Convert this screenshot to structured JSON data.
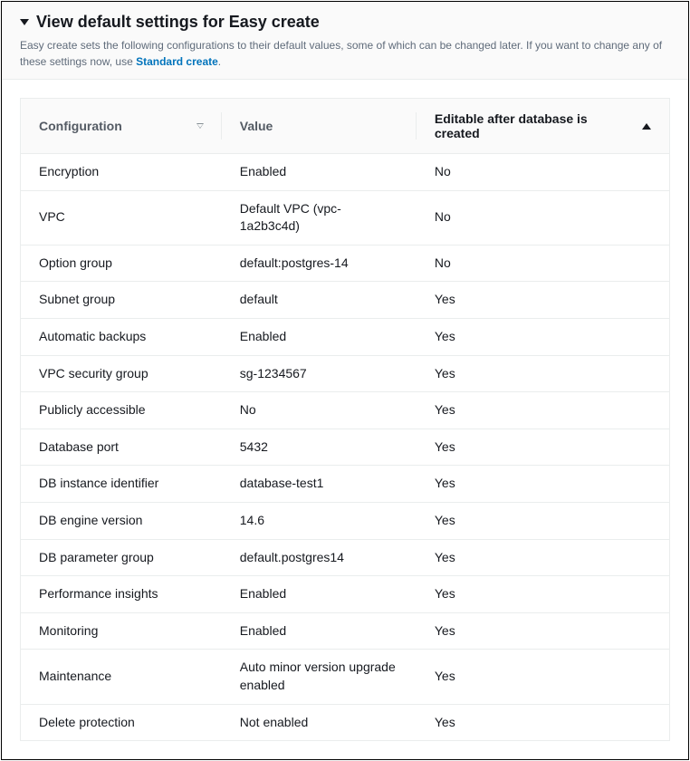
{
  "header": {
    "title": "View default settings for Easy create",
    "description_pre": "Easy create sets the following configurations to their default values, some of which can be changed later. If you want to change any of these settings now, use ",
    "link_text": "Standard create",
    "description_post": "."
  },
  "table": {
    "columns": {
      "config": "Configuration",
      "value": "Value",
      "editable": "Editable after database is created"
    },
    "rows": [
      {
        "config": "Encryption",
        "value": "Enabled",
        "editable": "No"
      },
      {
        "config": "VPC",
        "value": "Default VPC (vpc-1a2b3c4d)",
        "editable": "No"
      },
      {
        "config": "Option group",
        "value": "default:postgres-14",
        "editable": "No"
      },
      {
        "config": "Subnet group",
        "value": "default",
        "editable": "Yes"
      },
      {
        "config": "Automatic backups",
        "value": "Enabled",
        "editable": "Yes"
      },
      {
        "config": "VPC security group",
        "value": "sg-1234567",
        "editable": "Yes"
      },
      {
        "config": "Publicly accessible",
        "value": "No",
        "editable": "Yes"
      },
      {
        "config": "Database port",
        "value": "5432",
        "editable": "Yes"
      },
      {
        "config": "DB instance identifier",
        "value": "database-test1",
        "editable": "Yes"
      },
      {
        "config": "DB engine version",
        "value": "14.6",
        "editable": "Yes"
      },
      {
        "config": "DB parameter group",
        "value": "default.postgres14",
        "editable": "Yes"
      },
      {
        "config": "Performance insights",
        "value": "Enabled",
        "editable": "Yes"
      },
      {
        "config": "Monitoring",
        "value": "Enabled",
        "editable": "Yes"
      },
      {
        "config": "Maintenance",
        "value": "Auto minor version upgrade enabled",
        "editable": "Yes"
      },
      {
        "config": "Delete protection",
        "value": "Not enabled",
        "editable": "Yes"
      }
    ]
  }
}
